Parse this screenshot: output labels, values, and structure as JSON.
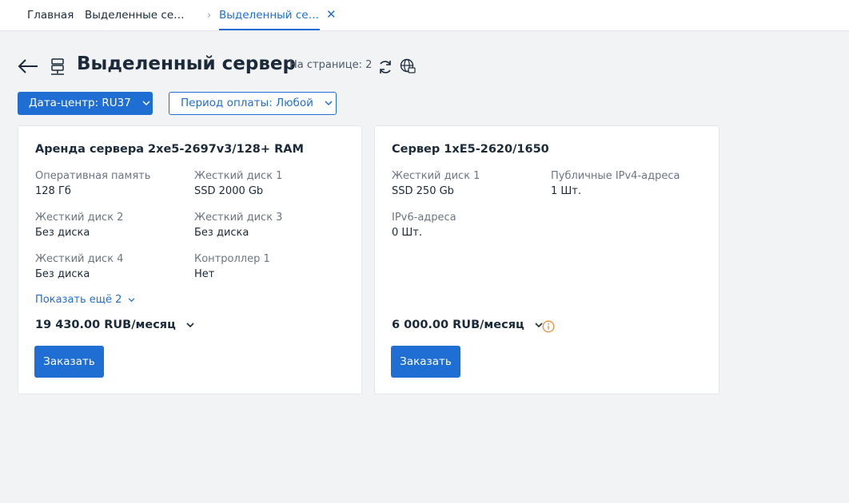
{
  "tabs": {
    "home": "Главная",
    "second": "Выделенные се…",
    "active": "Выделенный се…"
  },
  "header": {
    "title": "Выделенный сервер",
    "per_page": "На странице: 2"
  },
  "filters": {
    "datacenter": "Дата-центр: RU37",
    "payment_period": "Период оплаты: Любой"
  },
  "cards": [
    {
      "title": "Аренда сервера 2xe5-2697v3/128+ RAM",
      "specs": [
        {
          "label": "Оперативная память",
          "value": "128 Гб"
        },
        {
          "label": "Жесткий диск 1",
          "value": "SSD 2000 Gb"
        },
        {
          "label": "Жесткий диск 2",
          "value": "Без диска"
        },
        {
          "label": "Жесткий диск 3",
          "value": "Без диска"
        },
        {
          "label": "Жесткий диск 4",
          "value": "Без диска"
        },
        {
          "label": "Контроллер 1",
          "value": "Нет"
        }
      ],
      "show_more": "Показать ещё 2",
      "price": "19 430.00 RUB/месяц",
      "order": "Заказать"
    },
    {
      "title": "Сервер 1xE5-2620/1650",
      "specs": [
        {
          "label": "Жесткий диск 1",
          "value": "SSD 250 Gb"
        },
        {
          "label": "Публичные IPv4-адреса",
          "value": "1 Шт."
        },
        {
          "label": "IPv6-адреса",
          "value": "0 Шт."
        }
      ],
      "price": "6 000.00 RUB/месяц",
      "order": "Заказать"
    }
  ],
  "icons": {
    "back": "arrow-left-icon",
    "server": "server-icon",
    "refresh": "refresh-icon",
    "globe": "globe-icon",
    "info": "info-icon",
    "close": "close-icon",
    "chevron": "chevron-down-icon"
  },
  "colors": {
    "accent": "#1f6ed4",
    "info": "#e8913a",
    "background": "#f2f3f5"
  }
}
